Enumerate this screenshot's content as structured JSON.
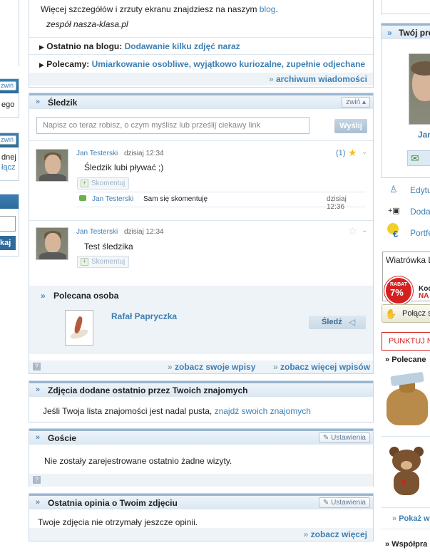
{
  "left_sidebar": {
    "zwin_label_1": "zwiń",
    "zwin_label_2": "zwiń",
    "text_ego": "ego",
    "text_dnej": "dnej",
    "link_lacz": "łącz",
    "button_kaj": "kaj"
  },
  "news": {
    "details_text": "Więcej szczegółów i zrzuty ekranu znajdziesz na naszym",
    "blog_link": "blog",
    "signature": "zespół nasza-klasa.pl",
    "last_blog_label": "Ostatnio na blogu:",
    "last_blog_link": "Dodawanie kilku zdjęć naraz",
    "recommend_label": "Polecamy:",
    "recommend_link": "Umiarkowanie osobliwe, wyjątkowo kuriozalne, zupełnie odjechane",
    "archive_link": "archiwum wiadomości"
  },
  "sledzik": {
    "title": "Śledzik",
    "collapse": "zwiń",
    "input_placeholder": "Napisz co teraz robisz, o czym myślisz lub prześlij ciekawy link",
    "send_button": "Wyślij",
    "posts": [
      {
        "author": "Jan Testerski",
        "time": "dzisiaj 12:34",
        "count": "(1)",
        "text": "Śledzik lubi pływać ;)",
        "comment_button": "Skomentuj",
        "comment": {
          "author": "Jan Testerski",
          "text": "Sam się skomentuję",
          "time": "dzisiaj 12:36"
        }
      },
      {
        "author": "Jan Testerski",
        "time": "dzisiaj 12:34",
        "text": "Test śledzika",
        "comment_button": "Skomentuj"
      }
    ],
    "recommended": {
      "title": "Polecana osoba",
      "name": "Rafał Papryczka",
      "follow_button": "Śledź"
    },
    "foot": {
      "help": "?",
      "own_posts": "zobacz swoje wpisy",
      "more_posts": "zobacz więcej wpisów"
    }
  },
  "photos": {
    "title": "Zdjęcia dodane ostatnio przez Twoich znajomych",
    "text": "Jeśli Twoja lista znajomości jest nadal pusta,",
    "link": "znajdź swoich znajomych"
  },
  "guests": {
    "title": "Goście",
    "settings": "Ustawienia",
    "text": "Nie zostały zarejestrowane ostatnio żadne wizyty.",
    "help": "?"
  },
  "opinion": {
    "title": "Ostatnia opinia o Twoim zdjęciu",
    "settings": "Ustawienia",
    "text": "Twoje zdjęcia nie otrzymały jeszcze opinii.",
    "more": "zobacz więcej"
  },
  "right_column": {
    "profile_title": "Twój pro",
    "profile_name": "Jan",
    "menu_edit": "Edytu",
    "menu_add": "Dodaj",
    "menu_wallet": "Portfe",
    "ad_title": "Wiatrówka L",
    "ad_badge_top": "RABAT",
    "ad_badge_pct": "7%",
    "ad_code": "Kod",
    "ad_na": "NA",
    "connect_button": "Połącz s",
    "points": "PUNKTUJ N",
    "recommended_title": "Polecane",
    "show_more": "Pokaż w",
    "cooperation": "Współpra"
  },
  "colors": {
    "accent": "#3d7fb3",
    "header_bg": "#dbe7f2",
    "ad_red": "#d42020"
  }
}
